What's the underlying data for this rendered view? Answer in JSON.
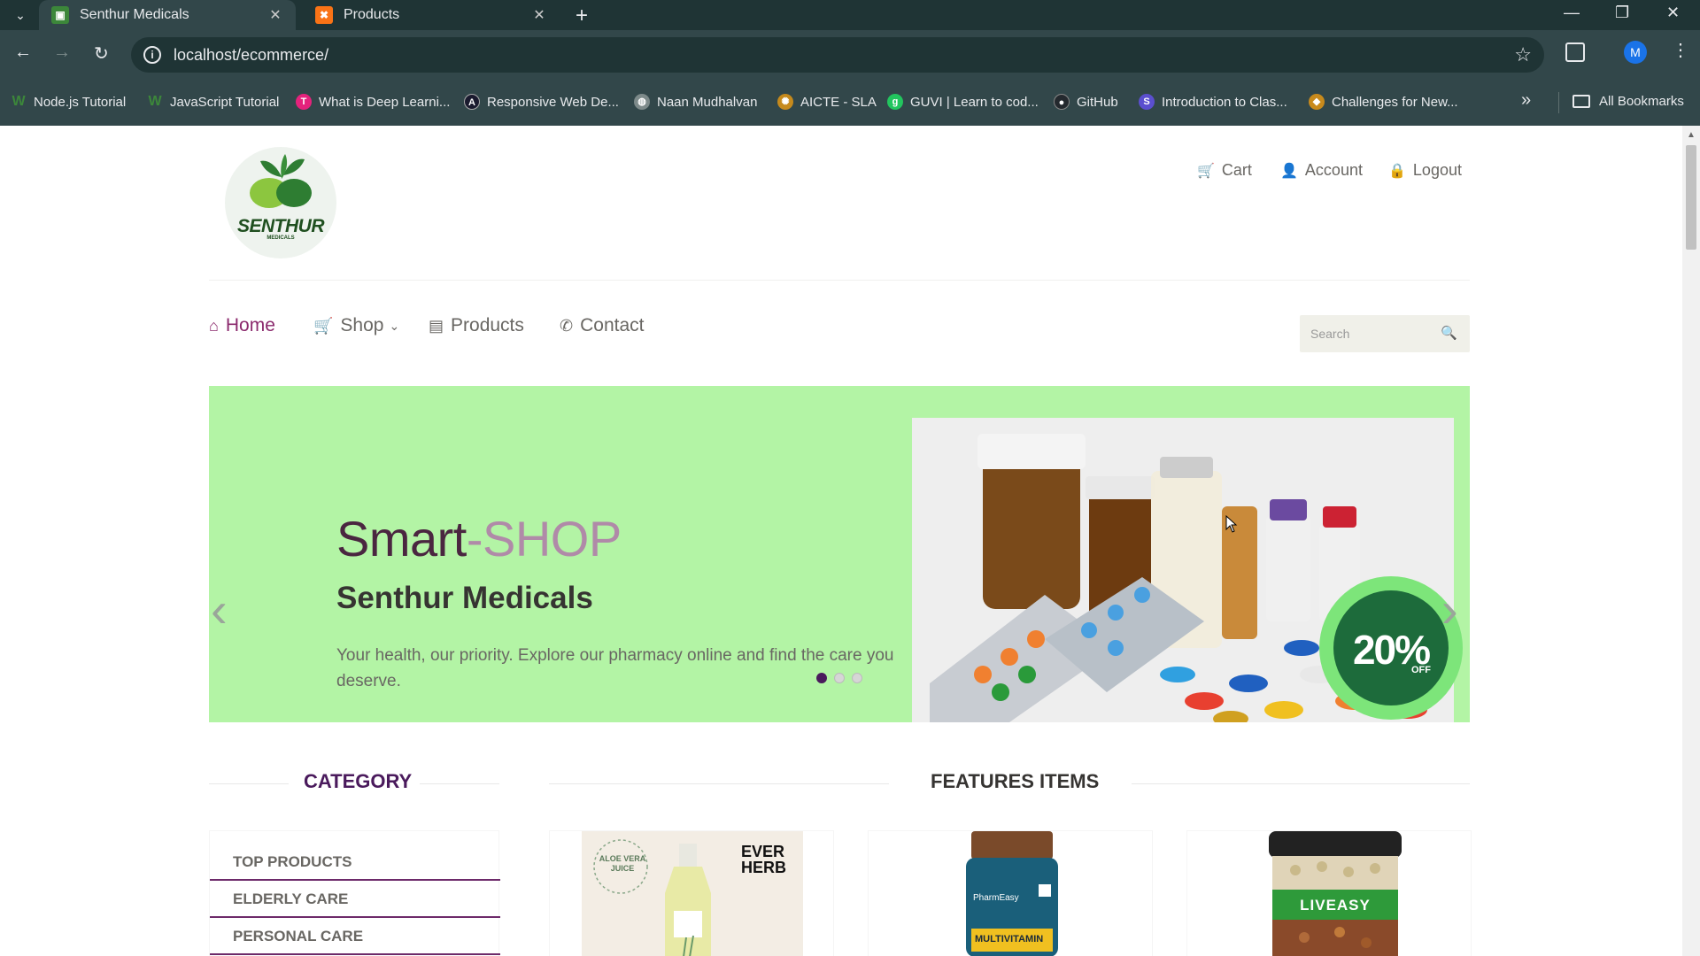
{
  "browser": {
    "tabs": [
      {
        "title": "Senthur Medicals",
        "active": true
      },
      {
        "title": "Products",
        "active": false
      }
    ],
    "url": "localhost/ecommerce/",
    "bookmarks": [
      {
        "label": "Node.js Tutorial",
        "color": "#3c873a",
        "icon": "W"
      },
      {
        "label": "JavaScript Tutorial",
        "color": "#3c873a",
        "icon": "W"
      },
      {
        "label": "What is Deep Learni...",
        "color": "#e5227c",
        "icon": "T"
      },
      {
        "label": "Responsive Web De...",
        "color": "#1a1a2e",
        "icon": "A"
      },
      {
        "label": "Naan Mudhalvan",
        "color": "#7d8a8a",
        "icon": "N"
      },
      {
        "label": "AICTE - SLA",
        "color": "#c68a1c",
        "icon": "A"
      },
      {
        "label": "GUVI | Learn to cod...",
        "color": "#22c55e",
        "icon": "G"
      },
      {
        "label": "GitHub",
        "color": "#24292e",
        "icon": "G"
      },
      {
        "label": "Introduction to Clas...",
        "color": "#5b4fcf",
        "icon": "S"
      },
      {
        "label": "Challenges for New...",
        "color": "#c88a1c",
        "icon": "C"
      }
    ],
    "all_bookmarks": "All Bookmarks",
    "profile_initial": "M"
  },
  "site": {
    "logo_text": "SENTHUR",
    "logo_sub": "MEDICALS",
    "top_nav": {
      "cart": "Cart",
      "account": "Account",
      "logout": "Logout"
    },
    "main_nav": {
      "home": "Home",
      "shop": "Shop",
      "products": "Products",
      "contact": "Contact"
    },
    "search_placeholder": "Search",
    "slider": {
      "title_main": "Smart",
      "title_accent": "-SHOP",
      "subtitle": "Senthur Medicals",
      "description": "Your health, our priority. Explore our pharmacy online and find the care you deserve.",
      "badge_value": "20%",
      "badge_text": "OFF",
      "active_dot": 0,
      "dot_count": 3
    },
    "category_title": "CATEGORY",
    "categories": [
      "TOP PRODUCTS",
      "ELDERLY CARE",
      "PERSONAL CARE"
    ],
    "features_title": "FEATURES ITEMS",
    "products": [
      {
        "label_top": "ALOE VERA JUICE",
        "brand": "EVER HERB"
      },
      {
        "label_top": "PharmEasy",
        "brand": "MULTIVITAMIN"
      },
      {
        "label_top": "LIVEASY",
        "brand": ""
      }
    ]
  },
  "colors": {
    "accent": "#8b2a6d",
    "slider_bg": "#b3f4a5",
    "category_title": "#4a1a5c",
    "badge": "#1d6b3b"
  }
}
